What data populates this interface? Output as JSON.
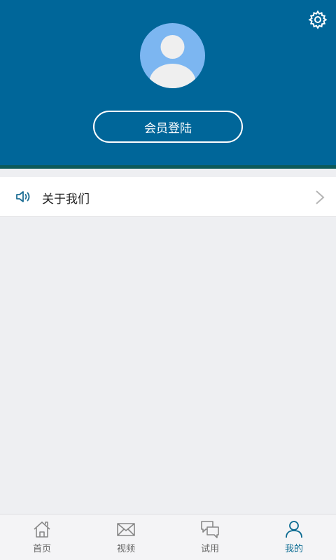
{
  "header": {
    "login_button_label": "会员登陆",
    "settings_icon": "gear-icon",
    "avatar_icon": "avatar-icon"
  },
  "menu": {
    "items": [
      {
        "label": "关于我们",
        "icon": "speaker-icon"
      }
    ]
  },
  "tabs": [
    {
      "label": "首页",
      "icon": "home-icon",
      "active": false
    },
    {
      "label": "视频",
      "icon": "envelope-icon",
      "active": false
    },
    {
      "label": "试用",
      "icon": "chat-icon",
      "active": false
    },
    {
      "label": "我的",
      "icon": "user-icon",
      "active": true
    }
  ],
  "colors": {
    "header_bg": "#006699",
    "avatar_bg": "#7cb6f1",
    "active_tab": "#0a6a91"
  }
}
